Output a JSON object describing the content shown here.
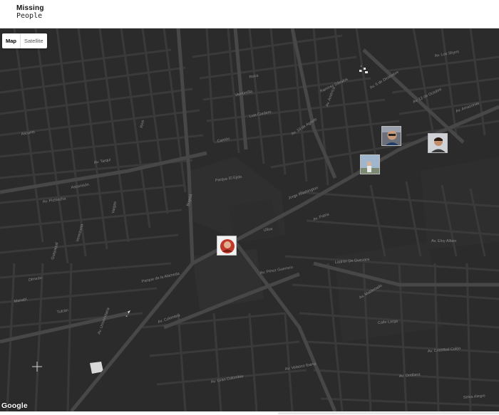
{
  "app": {
    "logo_line1": "Missing",
    "logo_line2": "People"
  },
  "map": {
    "type_control": {
      "options": [
        "Map",
        "Satellite"
      ],
      "selected": "Map"
    },
    "attribution": "Google",
    "style": "dark",
    "colors": {
      "background": "#2b2b2b",
      "block": "#303030",
      "street": "#3a3a3a",
      "avenue": "#474747",
      "label": "#8a8a8a"
    },
    "markers": [
      {
        "id": "person-1",
        "icon": "person-photo-icon"
      },
      {
        "id": "person-2",
        "icon": "person-photo-icon"
      },
      {
        "id": "person-3",
        "icon": "person-photo-icon"
      },
      {
        "id": "person-4",
        "icon": "person-photo-icon"
      }
    ],
    "street_labels": [
      "Av. Colombia",
      "Av. Gran Colombia",
      "Parque El Ejido",
      "Parque de la Alameda",
      "Av. 10 de Agosto",
      "Av. 6 de Diciembre",
      "Av. Patria",
      "Av. 12 de Octubre",
      "Av. Pichincha",
      "Av. Amazonas",
      "Av. Tarqui",
      "Av. Universitaria",
      "Luis Cordero",
      "Veintimilla",
      "Jorge Washington",
      "Roca",
      "Carrión",
      "Ramírez Dávalos",
      "Ascunsi",
      "Venezuela",
      "Guayaquil",
      "Manabí",
      "Olmedo",
      "Ríos",
      "Vargas",
      "Av. Pérez Guerrero",
      "Av. América",
      "Av. Los Shyris",
      "Av. Eloy Alfaro",
      "Calle Larga",
      "Av. Cristóbal Colón",
      "Ladrón De Guevara",
      "Av. Maldonado",
      "Av. Velasco Ibarra",
      "Av. Orellana",
      "Ascunsión",
      "Bogotá",
      "Tulcán",
      "Ulloa",
      "Selva Alegre"
    ]
  }
}
